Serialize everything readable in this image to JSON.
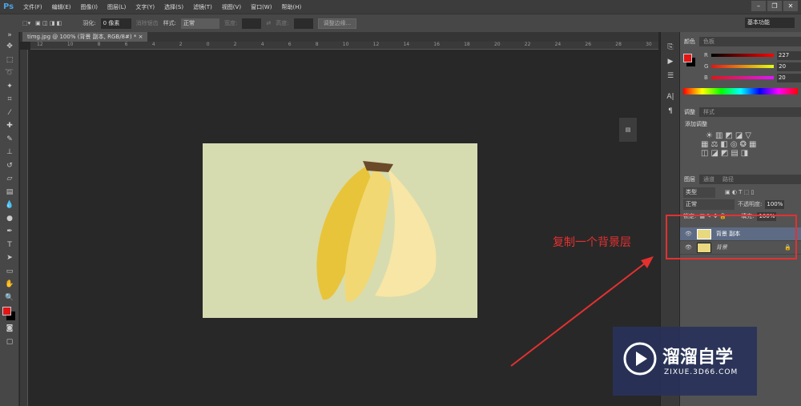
{
  "menubar": {
    "logo": "Ps",
    "items": [
      "文件(F)",
      "编辑(E)",
      "图像(I)",
      "图层(L)",
      "文字(Y)",
      "选择(S)",
      "滤镜(T)",
      "视图(V)",
      "窗口(W)",
      "帮助(H)"
    ]
  },
  "options": {
    "feather_label": "羽化:",
    "feather_value": "0 像素",
    "antialias": "消除锯齿",
    "style_label": "样式:",
    "style_value": "正常",
    "width_label": "宽度:",
    "height_label": "高度:",
    "refine_edge": "调整边缘...",
    "workspace": "基本功能"
  },
  "document": {
    "tab": "timg.jpg @ 100% (背景 副本, RGB/8#) *",
    "ruler_ticks": [
      "12",
      "10",
      "8",
      "6",
      "4",
      "2",
      "0",
      "2",
      "4",
      "6",
      "8",
      "10",
      "12",
      "14",
      "16",
      "18",
      "20",
      "22",
      "24",
      "26",
      "28",
      "30"
    ]
  },
  "annotation": "复制一个背景层",
  "color_panel": {
    "tabs": [
      "颜色",
      "色板"
    ],
    "channels": [
      {
        "label": "R",
        "value": "227"
      },
      {
        "label": "G",
        "value": "20"
      },
      {
        "label": "B",
        "value": "20"
      }
    ],
    "foreground": "#e31414",
    "background": "#000000"
  },
  "adjust_panel": {
    "tabs": [
      "调整",
      "样式"
    ],
    "title": "添加调整"
  },
  "layers_panel": {
    "tabs": [
      "图层",
      "通道",
      "路径"
    ],
    "filter": "类型",
    "blend": "正常",
    "opacity_label": "不透明度:",
    "opacity": "100%",
    "lock_label": "锁定:",
    "fill_label": "填充:",
    "fill": "100%",
    "layers": [
      {
        "name": "背景 副本",
        "selected": true
      },
      {
        "name": "背景",
        "locked": true
      }
    ]
  },
  "watermark": {
    "name": "溜溜自学",
    "url": "ZIXUE.3D66.COM"
  }
}
